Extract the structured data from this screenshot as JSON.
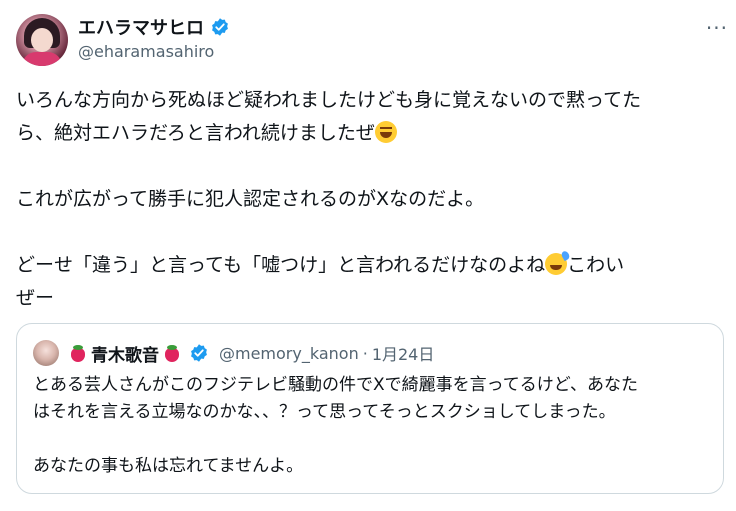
{
  "tweet": {
    "author": {
      "display_name": "エハラマサヒロ",
      "handle": "@eharamasahiro",
      "verified": true
    },
    "more_label": "···",
    "text_lines": [
      "いろんな方向から死ぬほど疑われましたけども身に覚えないので黙ってた",
      "ら、絶対エハラだろと言われ続けましたぜ",
      "",
      "これが広がって勝手に犯人認定されるのがXなのだよ。",
      "",
      "どーせ「違う」と言っても「嘘つけ」と言われるだけなのよね",
      "ぜー"
    ],
    "line4_suffix": "こわい",
    "emojis": {
      "grin": "grinning-squinting-face",
      "sweat": "grinning-face-with-sweat"
    }
  },
  "quoted": {
    "display_name": "青木歌音",
    "handle": "@memory_kanon",
    "separator": "·",
    "date": "1月24日",
    "verified": true,
    "text_lines": [
      "とある芸人さんがこのフジテレビ騒動の件でXで綺麗事を言ってるけど、あなた",
      "はそれを言える立場なのかな、、？って思ってそっとスクショしてしまった。",
      "",
      "あなたの事も私は忘れてませんよ。"
    ]
  },
  "colors": {
    "verified_blue": "#1d9bf0",
    "secondary_text": "#536471",
    "border": "#cfd9de"
  }
}
